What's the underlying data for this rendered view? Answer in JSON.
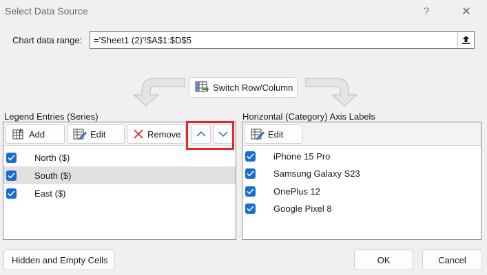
{
  "window": {
    "title": "Select Data Source",
    "help_label": "?",
    "close_label": "✕"
  },
  "range": {
    "label": "Chart data range:",
    "value": "='Sheet1 (2)'!$A$1:$D$5"
  },
  "switch_button": {
    "label": "Switch Row/Column"
  },
  "legend": {
    "label": "Legend Entries (Series)",
    "add_label": "Add",
    "edit_label": "Edit",
    "remove_label": "Remove",
    "series": [
      {
        "label": "North ($)",
        "checked": true,
        "selected": false
      },
      {
        "label": "South ($)",
        "checked": true,
        "selected": true
      },
      {
        "label": "East ($)",
        "checked": true,
        "selected": false
      }
    ]
  },
  "axis": {
    "label": "Horizontal (Category) Axis Labels",
    "edit_label": "Edit",
    "items": [
      {
        "label": "iPhone 15 Pro",
        "checked": true
      },
      {
        "label": "Samsung Galaxy S23",
        "checked": true
      },
      {
        "label": "OnePlus 12",
        "checked": true
      },
      {
        "label": "Google Pixel 8",
        "checked": true
      }
    ]
  },
  "footer": {
    "hidden_cells_label": "Hidden and Empty Cells",
    "ok_label": "OK",
    "cancel_label": "Cancel"
  },
  "colors": {
    "accent": "#1a6dd0",
    "highlight": "#e0262f"
  }
}
